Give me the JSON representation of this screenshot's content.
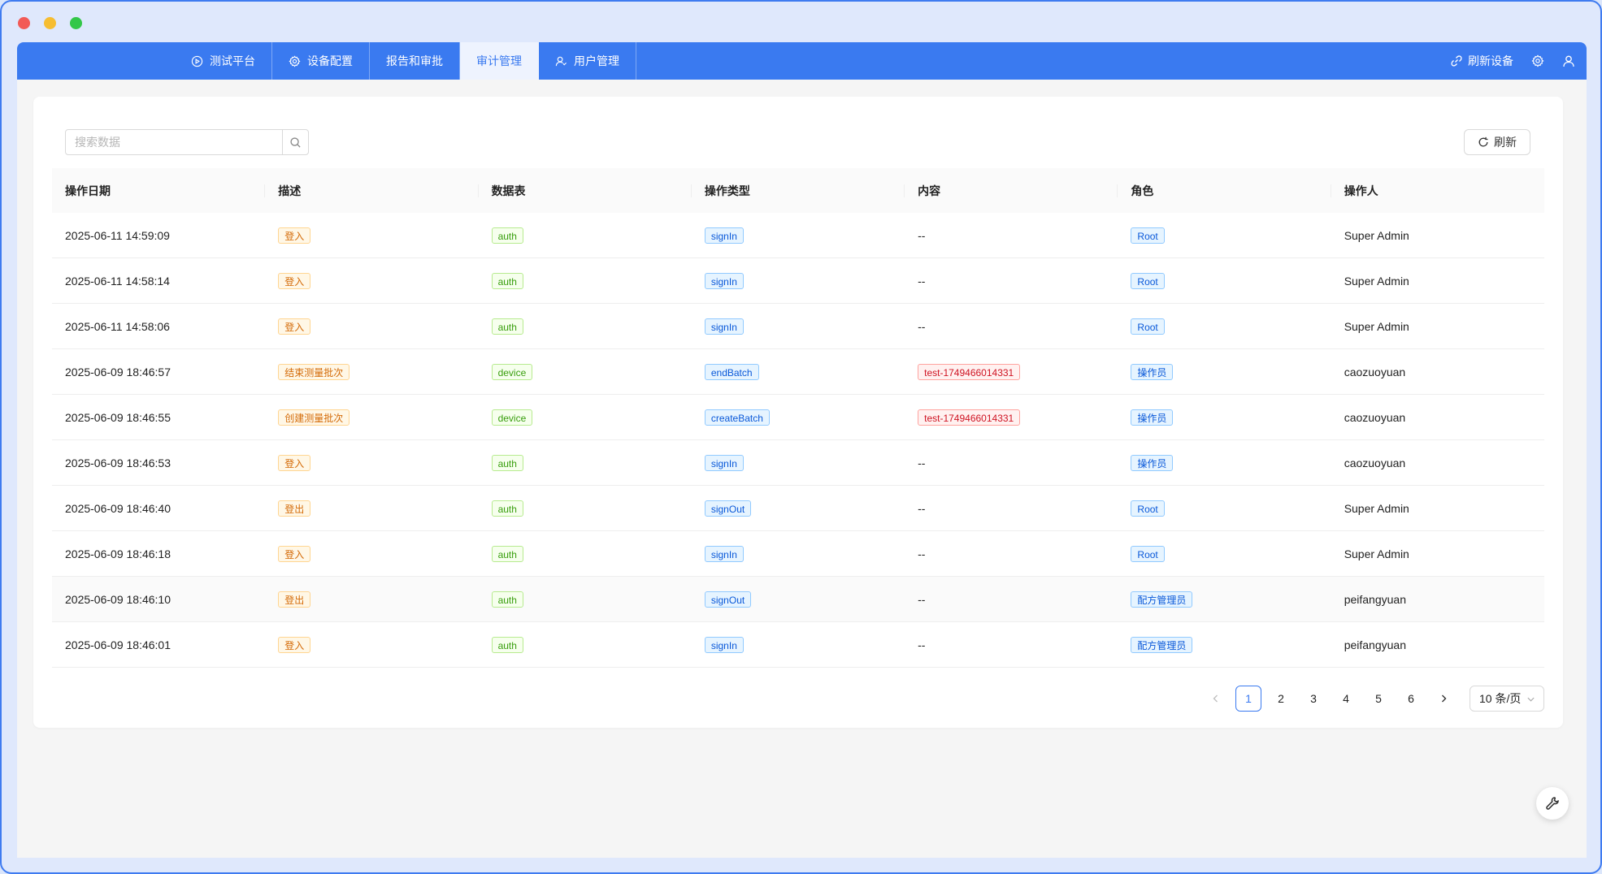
{
  "nav": {
    "tabs": [
      {
        "label": "测试平台",
        "icon": "play-circle-icon"
      },
      {
        "label": "设备配置",
        "icon": "gear-icon"
      },
      {
        "label": "报告和审批",
        "icon": ""
      },
      {
        "label": "审计管理",
        "icon": ""
      },
      {
        "label": "用户管理",
        "icon": "users-icon"
      }
    ],
    "active_tab": "审计管理",
    "refresh_devices": "刷新设备"
  },
  "toolbar": {
    "search_placeholder": "搜索数据",
    "refresh_label": "刷新"
  },
  "table": {
    "columns": [
      "操作日期",
      "描述",
      "数据表",
      "操作类型",
      "内容",
      "角色",
      "操作人"
    ],
    "rows": [
      {
        "date": "2025-06-11 14:59:09",
        "desc": "登入",
        "table": "auth",
        "op": "signIn",
        "content": "--",
        "role": "Root",
        "user": "Super Admin"
      },
      {
        "date": "2025-06-11 14:58:14",
        "desc": "登入",
        "table": "auth",
        "op": "signIn",
        "content": "--",
        "role": "Root",
        "user": "Super Admin"
      },
      {
        "date": "2025-06-11 14:58:06",
        "desc": "登入",
        "table": "auth",
        "op": "signIn",
        "content": "--",
        "role": "Root",
        "user": "Super Admin"
      },
      {
        "date": "2025-06-09 18:46:57",
        "desc": "结束测量批次",
        "table": "device",
        "op": "endBatch",
        "content": "test-1749466014331",
        "role": "操作员",
        "user": "caozuoyuan"
      },
      {
        "date": "2025-06-09 18:46:55",
        "desc": "创建测量批次",
        "table": "device",
        "op": "createBatch",
        "content": "test-1749466014331",
        "role": "操作员",
        "user": "caozuoyuan"
      },
      {
        "date": "2025-06-09 18:46:53",
        "desc": "登入",
        "table": "auth",
        "op": "signIn",
        "content": "--",
        "role": "操作员",
        "user": "caozuoyuan"
      },
      {
        "date": "2025-06-09 18:46:40",
        "desc": "登出",
        "table": "auth",
        "op": "signOut",
        "content": "--",
        "role": "Root",
        "user": "Super Admin"
      },
      {
        "date": "2025-06-09 18:46:18",
        "desc": "登入",
        "table": "auth",
        "op": "signIn",
        "content": "--",
        "role": "Root",
        "user": "Super Admin"
      },
      {
        "date": "2025-06-09 18:46:10",
        "desc": "登出",
        "table": "auth",
        "op": "signOut",
        "content": "--",
        "role": "配方管理员",
        "user": "peifangyuan"
      },
      {
        "date": "2025-06-09 18:46:01",
        "desc": "登入",
        "table": "auth",
        "op": "signIn",
        "content": "--",
        "role": "配方管理员",
        "user": "peifangyuan"
      }
    ]
  },
  "pagination": {
    "pages": [
      "1",
      "2",
      "3",
      "4",
      "5",
      "6"
    ],
    "current": "1",
    "page_size": "10 条/页"
  },
  "colors": {
    "primary": "#3a7af0",
    "tag_orange": "#d46b08",
    "tag_green": "#389e0d",
    "tag_blue": "#0958d9",
    "tag_red": "#cf1322"
  }
}
